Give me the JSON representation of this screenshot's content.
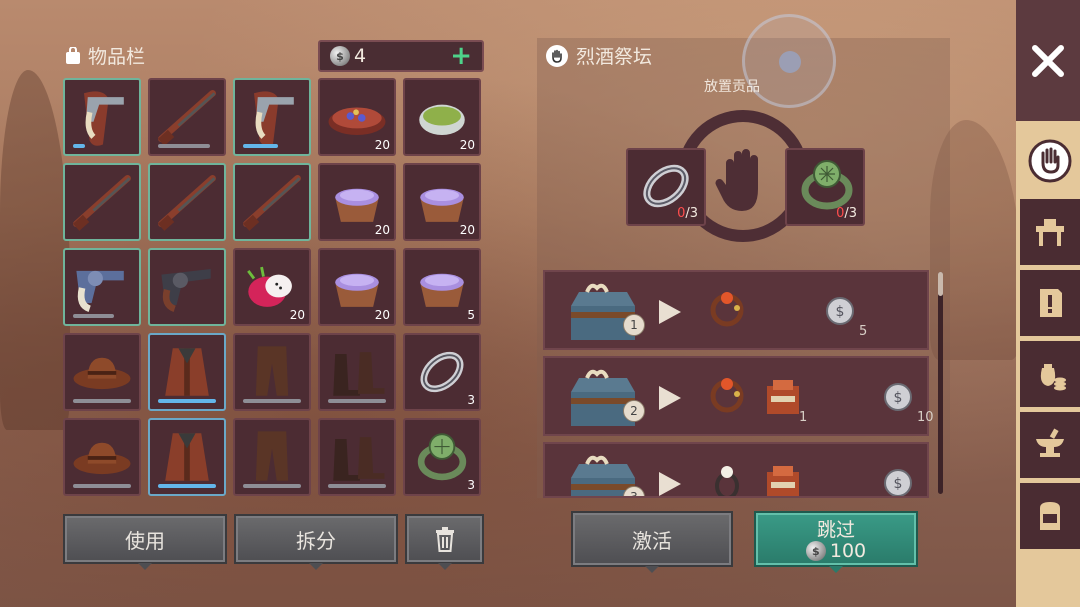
{
  "inventory": {
    "title": "物品栏",
    "currency": {
      "amount": "4",
      "add_label": "+"
    },
    "slots": [
      {
        "item": "revolver-holster-icon",
        "border": "green",
        "qty": "",
        "durability": 0.2,
        "bar": "blue"
      },
      {
        "item": "rifle-icon",
        "border": "",
        "qty": "",
        "durability": 0.9,
        "bar": "gray"
      },
      {
        "item": "revolver-holster-icon",
        "border": "green",
        "qty": "",
        "durability": 0.6,
        "bar": "blue"
      },
      {
        "item": "berry-pie-icon",
        "border": "",
        "qty": "20"
      },
      {
        "item": "green-soup-icon",
        "border": "",
        "qty": "20"
      },
      {
        "item": "rifle-icon",
        "border": "green",
        "qty": ""
      },
      {
        "item": "rifle-icon",
        "border": "green",
        "qty": ""
      },
      {
        "item": "rifle-icon",
        "border": "green",
        "qty": ""
      },
      {
        "item": "purple-pudding-icon",
        "border": "",
        "qty": "20"
      },
      {
        "item": "purple-pudding-icon",
        "border": "",
        "qty": "20"
      },
      {
        "item": "blue-revolver-icon",
        "border": "green",
        "qty": "",
        "durability": 0.7,
        "bar": "gray"
      },
      {
        "item": "dark-revolver-icon",
        "border": "green",
        "qty": ""
      },
      {
        "item": "dragonfruit-icon",
        "border": "",
        "qty": "20"
      },
      {
        "item": "purple-pudding-icon",
        "border": "",
        "qty": "20"
      },
      {
        "item": "purple-pudding-icon",
        "border": "",
        "qty": "5"
      },
      {
        "item": "cowboy-hat-icon",
        "border": "",
        "qty": "",
        "durability": 1,
        "bar": "gray"
      },
      {
        "item": "leather-coat-icon",
        "border": "blue",
        "qty": "",
        "durability": 1,
        "bar": "blue"
      },
      {
        "item": "leather-pants-icon",
        "border": "",
        "qty": "",
        "durability": 1,
        "bar": "gray"
      },
      {
        "item": "boots-icon",
        "border": "",
        "qty": "",
        "durability": 1,
        "bar": "gray"
      },
      {
        "item": "silver-ring-icon",
        "border": "",
        "qty": "3"
      },
      {
        "item": "cowboy-hat-icon",
        "border": "",
        "qty": "",
        "durability": 1,
        "bar": "gray"
      },
      {
        "item": "leather-coat-icon",
        "border": "blue",
        "qty": "",
        "durability": 1,
        "bar": "blue"
      },
      {
        "item": "leather-pants-icon",
        "border": "",
        "qty": "",
        "durability": 1,
        "bar": "gray"
      },
      {
        "item": "boots-icon",
        "border": "",
        "qty": "",
        "durability": 1,
        "bar": "gray"
      },
      {
        "item": "jade-ring-icon",
        "border": "",
        "qty": "3"
      }
    ],
    "use_label": "使用",
    "split_label": "拆分",
    "trash_icon": "trash-icon"
  },
  "altar": {
    "title": "烈酒祭坛",
    "offer_label": "放置贡品",
    "offer_slots": [
      {
        "item": "silver-ring-icon",
        "have": "0",
        "need": "/3"
      },
      {
        "item": "jade-ring-icon",
        "have": "0",
        "need": "/3"
      }
    ],
    "rewards": [
      {
        "level": "1",
        "items": [
          {
            "icon": "bracelet-icon",
            "qty": ""
          },
          {
            "icon": "silver-coin-icon",
            "qty": "5"
          }
        ]
      },
      {
        "level": "2",
        "items": [
          {
            "icon": "bracelet-icon",
            "qty": ""
          },
          {
            "icon": "supply-crate-icon",
            "qty": "1"
          },
          {
            "icon": "silver-coin-icon",
            "qty": "10"
          }
        ]
      },
      {
        "level": "3",
        "items": [
          {
            "icon": "pearl-ring-icon",
            "qty": ""
          },
          {
            "icon": "supply-crate-icon",
            "qty": ""
          },
          {
            "icon": "silver-coin-icon",
            "qty": ""
          }
        ]
      }
    ],
    "activate_label": "激活",
    "skip_label": "跳过",
    "skip_cost": "100"
  },
  "colors": {
    "skip_button": "#2f8a77",
    "accent_green": "#4ed38a",
    "danger_red": "#ff4d4d"
  },
  "sidebar": {
    "close_icon": "close-icon",
    "tabs": [
      "hand-icon",
      "workbench-icon",
      "map-icon",
      "coin-sack-icon",
      "anvil-icon",
      "backpack-icon"
    ]
  }
}
